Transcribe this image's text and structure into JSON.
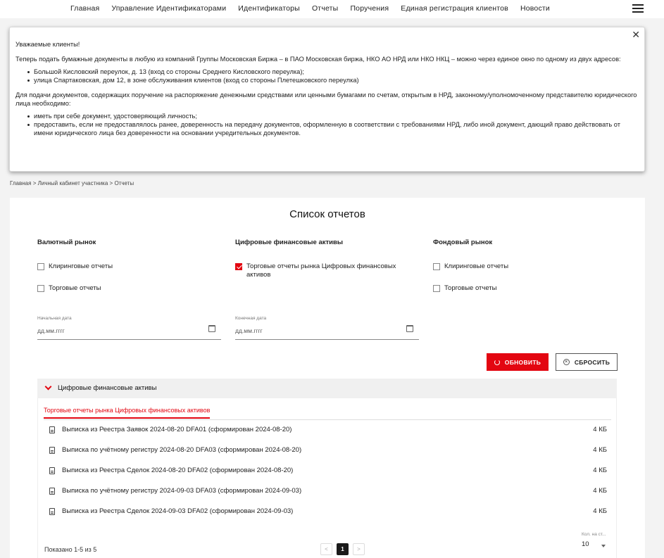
{
  "nav": {
    "items": [
      "Главная",
      "Управление Идентификаторами",
      "Идентификаторы",
      "Отчеты",
      "Поручения",
      "Единая регистрация клиентов",
      "Новости"
    ]
  },
  "notice": {
    "greeting": "Уважаемые клиенты!",
    "p1": "Теперь подать бумажные документы в любую из компаний Группы Московская Биржа – в ПАО Московская биржа, НКО АО НРД или НКО НКЦ – можно через единое окно по одному из двух адресов:",
    "addresses": [
      "Большой Кисловский переулок, д. 13 (вход со стороны Среднего Кисловского переулка);",
      "улица Спартаковская, дом 12, в зоне обслуживания клиентов (вход со стороны Плетешковского переулка)"
    ],
    "p2": "Для подачи документов, содержащих поручение на распоряжение денежными средствами или ценными бумагами по счетам, открытым в НРД, законному/уполномоченному представителю юридического лица необходимо:",
    "requirements": [
      "иметь при себе документ, удостоверяющий личность;",
      "предоставить, если не предоставлялось ранее, доверенность на передачу документов, оформленную в соответствии с требованиями НРД, либо иной документ, дающий право действовать от имени юридического лица без доверенности на основании учредительных документов."
    ],
    "close": "✕"
  },
  "breadcrumb": {
    "items": [
      "Главная",
      "Личный кабинет участника",
      "Отчеты"
    ],
    "sep": ">"
  },
  "page": {
    "title": "Список отчетов"
  },
  "filters": {
    "groups": [
      {
        "title": "Валютный рынок",
        "options": [
          {
            "label": "Клиринговые отчеты",
            "checked": false
          },
          {
            "label": "Торговые отчеты",
            "checked": false
          }
        ]
      },
      {
        "title": "Цифровые финансовые активы",
        "options": [
          {
            "label": "Торговые отчеты рынка Цифровых финансовых активов",
            "checked": true
          }
        ]
      },
      {
        "title": "Фондовый рынок",
        "options": [
          {
            "label": "Клиринговые отчеты",
            "checked": false
          },
          {
            "label": "Торговые отчеты",
            "checked": false
          }
        ]
      }
    ],
    "start_date": {
      "label": "Начальная дата",
      "placeholder": "дд.мм.гггг"
    },
    "end_date": {
      "label": "Конечная дата",
      "placeholder": "дд.мм.гггг"
    },
    "refresh_label": "ОБНОВИТЬ",
    "reset_label": "СБРОСИТЬ"
  },
  "results": {
    "section_title": "Цифровые финансовые активы",
    "tab_label": "Торговые отчеты рынка Цифровых финансовых активов",
    "files": [
      {
        "name": "Выписка из Реестра Заявок 2024-08-20 DFA01 (сформирован 2024-08-20)",
        "size": "4 КБ"
      },
      {
        "name": "Выписка по учётному регистру 2024-08-20 DFA03 (сформирован 2024-08-20)",
        "size": "4 КБ"
      },
      {
        "name": "Выписка из Реестра Сделок 2024-08-20 DFA02 (сформирован 2024-08-20)",
        "size": "4 КБ"
      },
      {
        "name": "Выписка по учётному регистру 2024-09-03 DFA03 (сформирован 2024-09-03)",
        "size": "4 КБ"
      },
      {
        "name": "Выписка из Реестра Сделок 2024-09-03 DFA02 (сформирован 2024-09-03)",
        "size": "4 КБ"
      }
    ],
    "shown_text": "Показано 1-5 из 5",
    "pager": {
      "prev": "<",
      "current": "1",
      "next": ">"
    },
    "per_page_label": "Кол. на ст...",
    "per_page_value": "10"
  },
  "colors": {
    "accent": "#e30611"
  }
}
